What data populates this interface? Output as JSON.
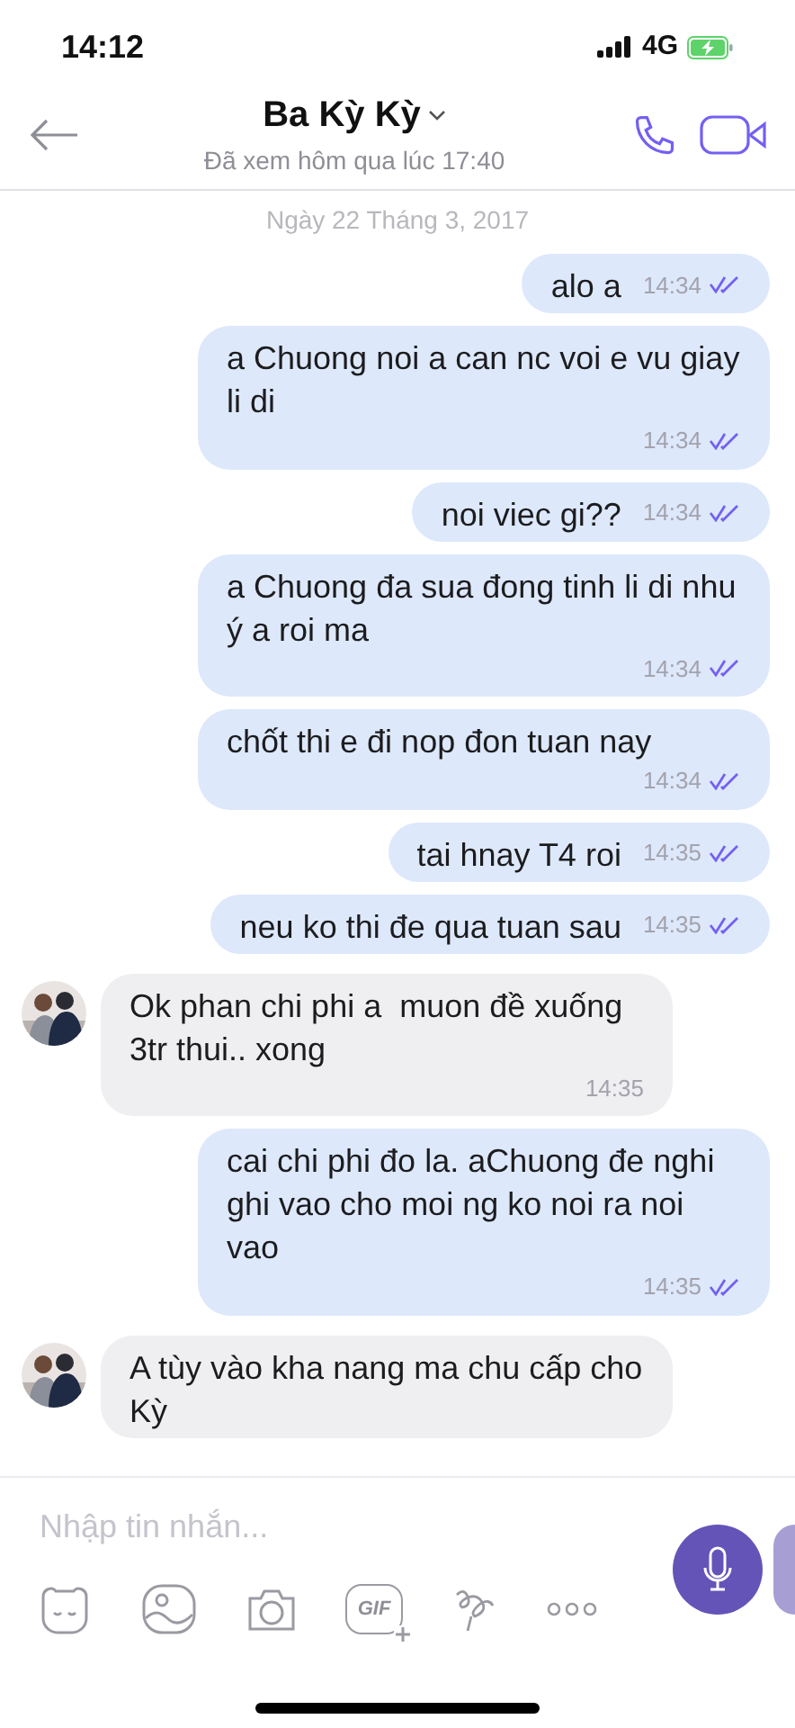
{
  "status_bar": {
    "time": "14:12",
    "network": "4G"
  },
  "header": {
    "title": "Ba Kỳ Kỳ",
    "subtitle": "Đã xem hôm qua lúc 17:40"
  },
  "date_divider": "Ngày 22 Tháng 3, 2017",
  "messages": [
    {
      "kind": "outgoing",
      "text": "alo a",
      "time": "14:34",
      "read": true
    },
    {
      "kind": "outgoing",
      "text": "a Chuong noi a can nc voi e vu giay li di",
      "time": "14:34",
      "read": true
    },
    {
      "kind": "outgoing",
      "text": "noi viec gi??",
      "time": "14:34",
      "read": true
    },
    {
      "kind": "outgoing",
      "text": "a Chuong đa sua đong tinh li di nhu ý a roi ma",
      "time": "14:34",
      "read": true
    },
    {
      "kind": "outgoing",
      "text": "chốt thi e đi nop đon tuan nay",
      "time": "14:34",
      "read": true
    },
    {
      "kind": "outgoing",
      "text": "tai hnay T4 roi",
      "time": "14:35",
      "read": true
    },
    {
      "kind": "outgoing",
      "text": "neu ko thi đe qua tuan sau",
      "time": "14:35",
      "read": true
    },
    {
      "kind": "incoming",
      "text": "Ok phan chi phi a  muon đề xuống 3tr thui.. xong",
      "time": "14:35"
    },
    {
      "kind": "outgoing",
      "text": "cai chi phi đo la. aChuong đe nghi ghi vao cho moi ng ko noi ra noi vao",
      "time": "14:35",
      "read": true
    },
    {
      "kind": "incoming",
      "text": "A tùy vào kha nang ma chu cấp cho Kỳ"
    }
  ],
  "composer": {
    "placeholder": "Nhập tin nhắn...",
    "gif_label": "GIF"
  }
}
